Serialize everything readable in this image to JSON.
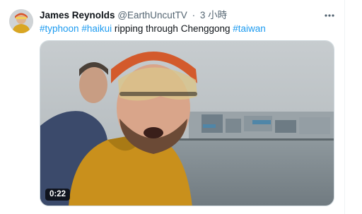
{
  "author": {
    "name": "James Reynolds",
    "handle": "@EarthUncutTV",
    "separator": "·",
    "time": "3 小時"
  },
  "tweet": {
    "hashtag_1": "#typhoon",
    "hashtag_2": "#haikui",
    "text_middle": "ripping through Chenggong",
    "hashtag_3": "#taiwan"
  },
  "video": {
    "duration": "0:22"
  },
  "icons": {
    "more": "more-dots-icon"
  },
  "colors": {
    "link": "#1d9bf0",
    "text": "#0f1419",
    "secondary": "#536471"
  }
}
